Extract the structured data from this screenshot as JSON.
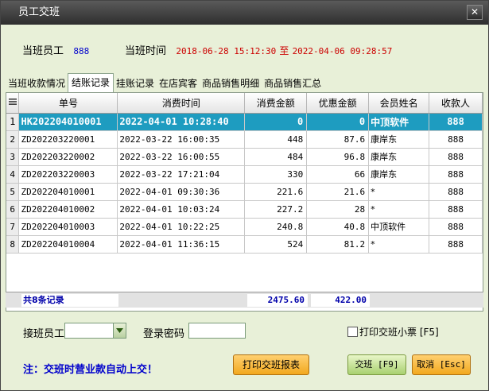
{
  "window": {
    "title": "员工交班",
    "close_glyph": "✕"
  },
  "info": {
    "staff_label": "当班员工",
    "staff_value": "888",
    "time_label": "当班时间",
    "time_start": "2018-06-28 15:12:30",
    "time_sep": "至",
    "time_end": "2022-04-06 09:28:57"
  },
  "tabs": [
    {
      "label": "当班收款情况",
      "active": false
    },
    {
      "label": "结账记录",
      "active": true
    },
    {
      "label": "挂账记录",
      "active": false
    },
    {
      "label": "在店宾客",
      "active": false
    },
    {
      "label": "商品销售明细",
      "active": false
    },
    {
      "label": "商品销售汇总",
      "active": false
    }
  ],
  "table": {
    "row_header_icon": "list-icon",
    "columns": [
      "单号",
      "消费时间",
      "消费金额",
      "优惠金额",
      "会员姓名",
      "收款人"
    ],
    "rows": [
      {
        "idx": "1",
        "order": "HK202204010001",
        "time": "2022-04-01 10:28:40",
        "amount": "0",
        "discount": "0",
        "member": "中顶软件",
        "cashier": "888",
        "selected": true
      },
      {
        "idx": "2",
        "order": "ZD202203220001",
        "time": "2022-03-22 16:00:35",
        "amount": "448",
        "discount": "87.6",
        "member": "康岸东",
        "cashier": "888"
      },
      {
        "idx": "3",
        "order": "ZD202203220002",
        "time": "2022-03-22 16:00:55",
        "amount": "484",
        "discount": "96.8",
        "member": "康岸东",
        "cashier": "888"
      },
      {
        "idx": "4",
        "order": "ZD202203220003",
        "time": "2022-03-22 17:21:04",
        "amount": "330",
        "discount": "66",
        "member": "康岸东",
        "cashier": "888"
      },
      {
        "idx": "5",
        "order": "ZD202204010001",
        "time": "2022-04-01 09:30:36",
        "amount": "221.6",
        "discount": "21.6",
        "member": "*",
        "cashier": "888"
      },
      {
        "idx": "6",
        "order": "ZD202204010002",
        "time": "2022-04-01 10:03:24",
        "amount": "227.2",
        "discount": "28",
        "member": "*",
        "cashier": "888"
      },
      {
        "idx": "7",
        "order": "ZD202204010003",
        "time": "2022-04-01 10:22:25",
        "amount": "240.8",
        "discount": "40.8",
        "member": "中顶软件",
        "cashier": "888"
      },
      {
        "idx": "8",
        "order": "ZD202204010004",
        "time": "2022-04-01 11:36:15",
        "amount": "524",
        "discount": "81.2",
        "member": "*",
        "cashier": "888"
      }
    ],
    "summary": {
      "count_label": "共8条记录",
      "total_amount": "2475.60",
      "total_discount": "422.00"
    }
  },
  "handover": {
    "next_staff_label": "接班员工",
    "next_staff_value": "",
    "password_label": "登录密码",
    "password_value": "",
    "print_ticket_label": "打印交班小票 [F5]",
    "print_ticket_checked": false
  },
  "footer": {
    "note": "注：交班时营业款自动上交！",
    "print_report_label": "打印交班报表",
    "handover_button_label": "交班 [F9]",
    "cancel_button_label": "取消 [Esc]"
  },
  "colors": {
    "selected_row": "#1e9cc0",
    "accent_red": "#cc0000",
    "accent_blue": "#0000cc",
    "window_bg": "#e8f0d8"
  }
}
